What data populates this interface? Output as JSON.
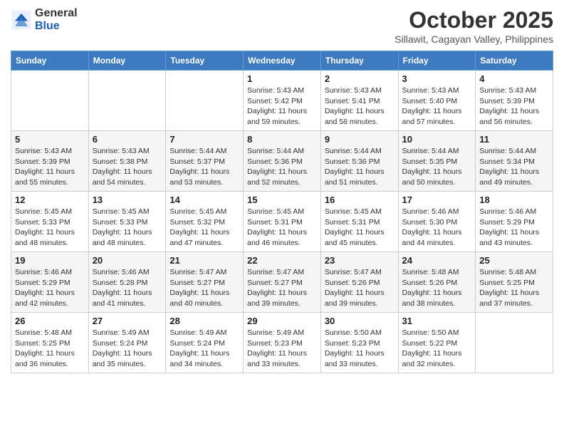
{
  "logo": {
    "general": "General",
    "blue": "Blue"
  },
  "title": "October 2025",
  "subtitle": "Sillawit, Cagayan Valley, Philippines",
  "days_of_week": [
    "Sunday",
    "Monday",
    "Tuesday",
    "Wednesday",
    "Thursday",
    "Friday",
    "Saturday"
  ],
  "weeks": [
    [
      {
        "day": "",
        "info": ""
      },
      {
        "day": "",
        "info": ""
      },
      {
        "day": "",
        "info": ""
      },
      {
        "day": "1",
        "info": "Sunrise: 5:43 AM\nSunset: 5:42 PM\nDaylight: 11 hours\nand 59 minutes."
      },
      {
        "day": "2",
        "info": "Sunrise: 5:43 AM\nSunset: 5:41 PM\nDaylight: 11 hours\nand 58 minutes."
      },
      {
        "day": "3",
        "info": "Sunrise: 5:43 AM\nSunset: 5:40 PM\nDaylight: 11 hours\nand 57 minutes."
      },
      {
        "day": "4",
        "info": "Sunrise: 5:43 AM\nSunset: 5:39 PM\nDaylight: 11 hours\nand 56 minutes."
      }
    ],
    [
      {
        "day": "5",
        "info": "Sunrise: 5:43 AM\nSunset: 5:39 PM\nDaylight: 11 hours\nand 55 minutes."
      },
      {
        "day": "6",
        "info": "Sunrise: 5:43 AM\nSunset: 5:38 PM\nDaylight: 11 hours\nand 54 minutes."
      },
      {
        "day": "7",
        "info": "Sunrise: 5:44 AM\nSunset: 5:37 PM\nDaylight: 11 hours\nand 53 minutes."
      },
      {
        "day": "8",
        "info": "Sunrise: 5:44 AM\nSunset: 5:36 PM\nDaylight: 11 hours\nand 52 minutes."
      },
      {
        "day": "9",
        "info": "Sunrise: 5:44 AM\nSunset: 5:36 PM\nDaylight: 11 hours\nand 51 minutes."
      },
      {
        "day": "10",
        "info": "Sunrise: 5:44 AM\nSunset: 5:35 PM\nDaylight: 11 hours\nand 50 minutes."
      },
      {
        "day": "11",
        "info": "Sunrise: 5:44 AM\nSunset: 5:34 PM\nDaylight: 11 hours\nand 49 minutes."
      }
    ],
    [
      {
        "day": "12",
        "info": "Sunrise: 5:45 AM\nSunset: 5:33 PM\nDaylight: 11 hours\nand 48 minutes."
      },
      {
        "day": "13",
        "info": "Sunrise: 5:45 AM\nSunset: 5:33 PM\nDaylight: 11 hours\nand 48 minutes."
      },
      {
        "day": "14",
        "info": "Sunrise: 5:45 AM\nSunset: 5:32 PM\nDaylight: 11 hours\nand 47 minutes."
      },
      {
        "day": "15",
        "info": "Sunrise: 5:45 AM\nSunset: 5:31 PM\nDaylight: 11 hours\nand 46 minutes."
      },
      {
        "day": "16",
        "info": "Sunrise: 5:45 AM\nSunset: 5:31 PM\nDaylight: 11 hours\nand 45 minutes."
      },
      {
        "day": "17",
        "info": "Sunrise: 5:46 AM\nSunset: 5:30 PM\nDaylight: 11 hours\nand 44 minutes."
      },
      {
        "day": "18",
        "info": "Sunrise: 5:46 AM\nSunset: 5:29 PM\nDaylight: 11 hours\nand 43 minutes."
      }
    ],
    [
      {
        "day": "19",
        "info": "Sunrise: 5:46 AM\nSunset: 5:29 PM\nDaylight: 11 hours\nand 42 minutes."
      },
      {
        "day": "20",
        "info": "Sunrise: 5:46 AM\nSunset: 5:28 PM\nDaylight: 11 hours\nand 41 minutes."
      },
      {
        "day": "21",
        "info": "Sunrise: 5:47 AM\nSunset: 5:27 PM\nDaylight: 11 hours\nand 40 minutes."
      },
      {
        "day": "22",
        "info": "Sunrise: 5:47 AM\nSunset: 5:27 PM\nDaylight: 11 hours\nand 39 minutes."
      },
      {
        "day": "23",
        "info": "Sunrise: 5:47 AM\nSunset: 5:26 PM\nDaylight: 11 hours\nand 39 minutes."
      },
      {
        "day": "24",
        "info": "Sunrise: 5:48 AM\nSunset: 5:26 PM\nDaylight: 11 hours\nand 38 minutes."
      },
      {
        "day": "25",
        "info": "Sunrise: 5:48 AM\nSunset: 5:25 PM\nDaylight: 11 hours\nand 37 minutes."
      }
    ],
    [
      {
        "day": "26",
        "info": "Sunrise: 5:48 AM\nSunset: 5:25 PM\nDaylight: 11 hours\nand 36 minutes."
      },
      {
        "day": "27",
        "info": "Sunrise: 5:49 AM\nSunset: 5:24 PM\nDaylight: 11 hours\nand 35 minutes."
      },
      {
        "day": "28",
        "info": "Sunrise: 5:49 AM\nSunset: 5:24 PM\nDaylight: 11 hours\nand 34 minutes."
      },
      {
        "day": "29",
        "info": "Sunrise: 5:49 AM\nSunset: 5:23 PM\nDaylight: 11 hours\nand 33 minutes."
      },
      {
        "day": "30",
        "info": "Sunrise: 5:50 AM\nSunset: 5:23 PM\nDaylight: 11 hours\nand 33 minutes."
      },
      {
        "day": "31",
        "info": "Sunrise: 5:50 AM\nSunset: 5:22 PM\nDaylight: 11 hours\nand 32 minutes."
      },
      {
        "day": "",
        "info": ""
      }
    ]
  ]
}
